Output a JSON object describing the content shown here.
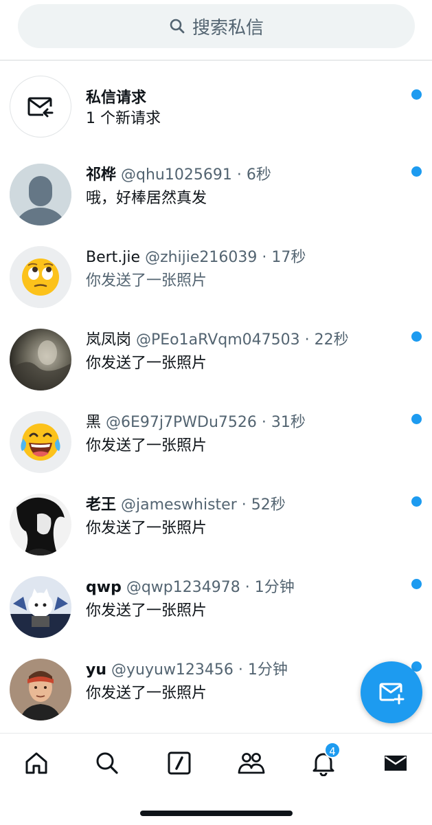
{
  "search": {
    "placeholder": "搜索私信"
  },
  "request": {
    "title": "私信请求",
    "subtitle": "1 个新请求"
  },
  "conversations": [
    {
      "name": "祁桦",
      "handle": "@qhu1025691 · 6秒",
      "message": "哦，好棒居然真发",
      "unread": true,
      "avatar": "default-avatar"
    },
    {
      "name": "Bert.jie",
      "handle": "@zhijie216039 · 17秒",
      "message": "你发送了一张照片",
      "unread": false,
      "avatar": "eye-roll-emoji"
    },
    {
      "name": "岚凤岗",
      "handle": "@PEo1aRVqm047503 · 22秒",
      "message": "你发送了一张照片",
      "unread": true,
      "avatar": "photo-avatar"
    },
    {
      "name": "黑",
      "handle": "@6E97j7PWDu7526 · 31秒",
      "message": "你发送了一张照片",
      "unread": true,
      "avatar": "laughing-emoji"
    },
    {
      "name": "老王",
      "handle": "@jameswhister · 52秒",
      "message": "你发送了一张照片",
      "unread": true,
      "avatar": "anime-avatar"
    },
    {
      "name": "qwp",
      "handle": "@qwp1234978 · 1分钟",
      "message": "你发送了一张照片",
      "unread": true,
      "avatar": "cat-avatar"
    },
    {
      "name": "yu",
      "handle": "@yuyuw123456 · 1分钟",
      "message": "你发送了一张照片",
      "unread": true,
      "avatar": "person-photo-avatar"
    }
  ],
  "nav": {
    "items": [
      "home",
      "search",
      "spaces",
      "communities",
      "notifications",
      "messages"
    ],
    "notifications_badge": "4"
  },
  "colors": {
    "accent": "#1d9bf0",
    "secondary_text": "#536471",
    "text": "#0f1419"
  }
}
